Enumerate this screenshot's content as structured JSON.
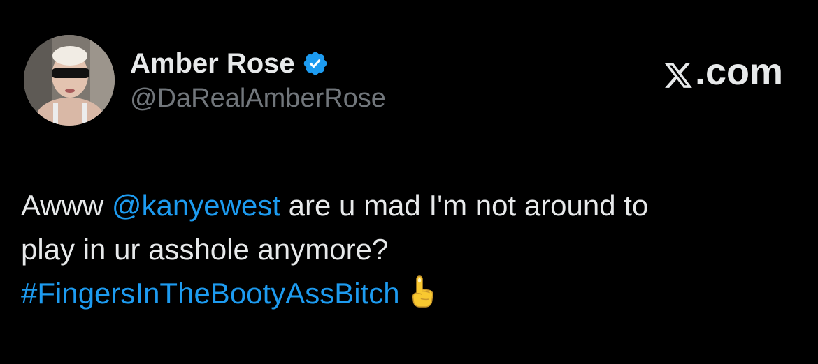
{
  "tweet": {
    "author": {
      "display_name": "Amber Rose",
      "handle": "@DaRealAmberRose",
      "verified": true
    },
    "site": {
      "brand_suffix": ".com",
      "icon": "x-logo-icon"
    },
    "body": {
      "line1_prefix": "Awww ",
      "mention": "@kanyewest",
      "line1_suffix": " are u mad I'm not around to",
      "line2": "play in ur asshole anymore?",
      "hashtag": "#FingersInTheBootyAssBitch",
      "emoji": "pointing-up-hand-icon"
    }
  },
  "colors": {
    "background": "#000000",
    "text_primary": "#e7e9ea",
    "text_secondary": "#71767b",
    "link_blue": "#1d9bf0",
    "verified_blue": "#1d9bf0"
  }
}
